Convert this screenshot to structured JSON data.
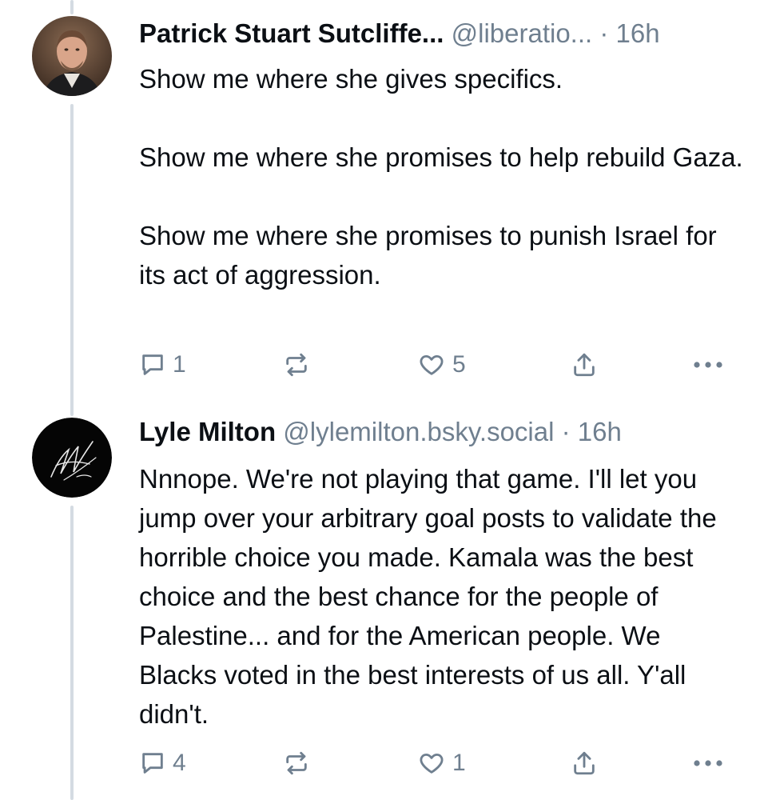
{
  "posts": [
    {
      "display_name": "Patrick Stuart Sutcliffe...",
      "handle": "@liberatio...",
      "separator": "·",
      "time": "16h",
      "body": "Show me where she gives specifics.\n\nShow me where she promises to help rebuild Gaza.\n\nShow me where she promises to punish Israel for its act of aggression.",
      "reply_count": "1",
      "repost_count": "",
      "like_count": "5",
      "avatar_icon": "profile-photo-man"
    },
    {
      "display_name": "Lyle Milton",
      "handle": "@lylemilton.bsky.social",
      "separator": "·",
      "time": "16h",
      "body": "Nnnope. We're not playing that game. I'll let you jump over your arbitrary goal posts to validate the horrible choice you made. Kamala was the best choice and the best chance for the people of Palestine... and for the American people. We Blacks voted in the best interests of us all. Y'all didn't.",
      "reply_count": "4",
      "repost_count": "",
      "like_count": "1",
      "avatar_icon": "signature-logo"
    }
  ],
  "icons": {
    "reply": "reply-icon",
    "repost": "repost-icon",
    "like": "heart-icon",
    "share": "share-icon",
    "more": "more-icon"
  },
  "colors": {
    "text": "#0b0f14",
    "muted": "#6f7f8f",
    "thread_line": "#d4dbe2"
  }
}
